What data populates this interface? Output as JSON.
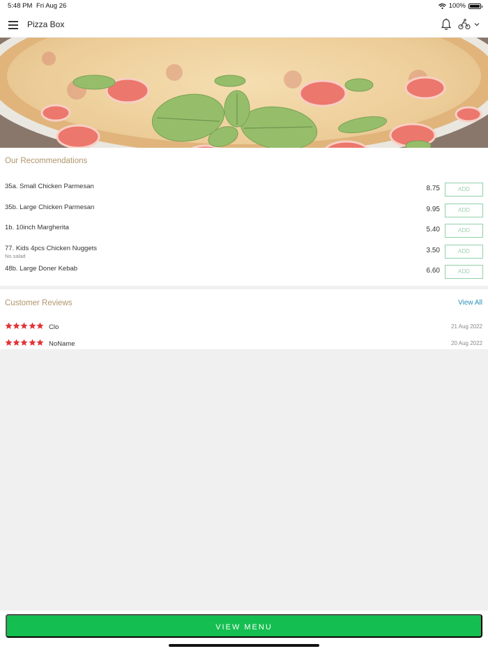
{
  "status_bar": {
    "time": "5:48 PM",
    "date": "Fri Aug 26",
    "battery": "100%",
    "battery_level": 1.0
  },
  "header": {
    "title": "Pizza Box"
  },
  "recommendations": {
    "title": "Our Recommendations",
    "add_label": "ADD",
    "items": [
      {
        "name": "35a. Small Chicken Parmesan",
        "note": "",
        "price": "8.75"
      },
      {
        "name": "35b. Large Chicken Parmesan",
        "note": "",
        "price": "9.95"
      },
      {
        "name": "1b. 10inch Margherita",
        "note": "",
        "price": "5.40"
      },
      {
        "name": "77. Kids 4pcs Chicken Nuggets",
        "note": "No salad",
        "price": "3.50"
      },
      {
        "name": "48b. Large Doner Kebab",
        "note": "",
        "price": "6.60"
      }
    ]
  },
  "reviews": {
    "title": "Customer Reviews",
    "view_all": "View All",
    "items": [
      {
        "name": "Clo",
        "date": "21 Aug 2022",
        "rating": 5
      },
      {
        "name": "NoName",
        "date": "20 Aug 2022",
        "rating": 5
      }
    ]
  },
  "footer": {
    "button": "VIEW MENU"
  },
  "colors": {
    "accent_green": "#14be50",
    "section_title": "#b0956a",
    "link_blue": "#2a8fb8",
    "star_red": "#e0353a"
  },
  "icons": [
    "hamburger-menu-icon",
    "bell-icon",
    "rider-icon",
    "chevron-down-icon",
    "wifi-icon",
    "battery-icon",
    "star-icon"
  ]
}
